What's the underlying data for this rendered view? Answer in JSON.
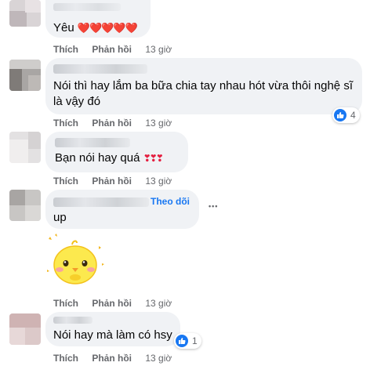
{
  "comments": [
    {
      "text": "Yêu",
      "emoji": "❤️❤️❤️❤️❤️",
      "like_label": "Thích",
      "reply_label": "Phản hồi",
      "time": "13 giờ"
    },
    {
      "line1": "Nói thì hay lắm ba bữa chia tay nhau hót vừa thôi nghệ sĩ",
      "line2": "là vậy đó",
      "like_label": "Thích",
      "reply_label": "Phản hồi",
      "time": "13 giờ",
      "reaction_count": "4"
    },
    {
      "text": "Bạn nói hay quá",
      "like_label": "Thích",
      "reply_label": "Phản hồi",
      "time": "13 giờ"
    },
    {
      "follow_label": "Theo dõi",
      "text": "up",
      "more_label": "•••",
      "sticker_name": "yellow-chick-sticker",
      "like_label": "Thích",
      "reply_label": "Phản hồi",
      "time": "13 giờ"
    },
    {
      "text": "Nói hay mà làm có hsy",
      "like_label": "Thích",
      "reply_label": "Phản hồi",
      "time": "13 giờ",
      "reaction_count": "1"
    }
  ],
  "colors": {
    "bubble": "#f0f2f5",
    "meta": "#65676b",
    "link": "#1877f2",
    "heart": "#e41e3f"
  },
  "icons": {
    "like": "thumbs-up-icon",
    "more": "more-horizontal-icon"
  }
}
